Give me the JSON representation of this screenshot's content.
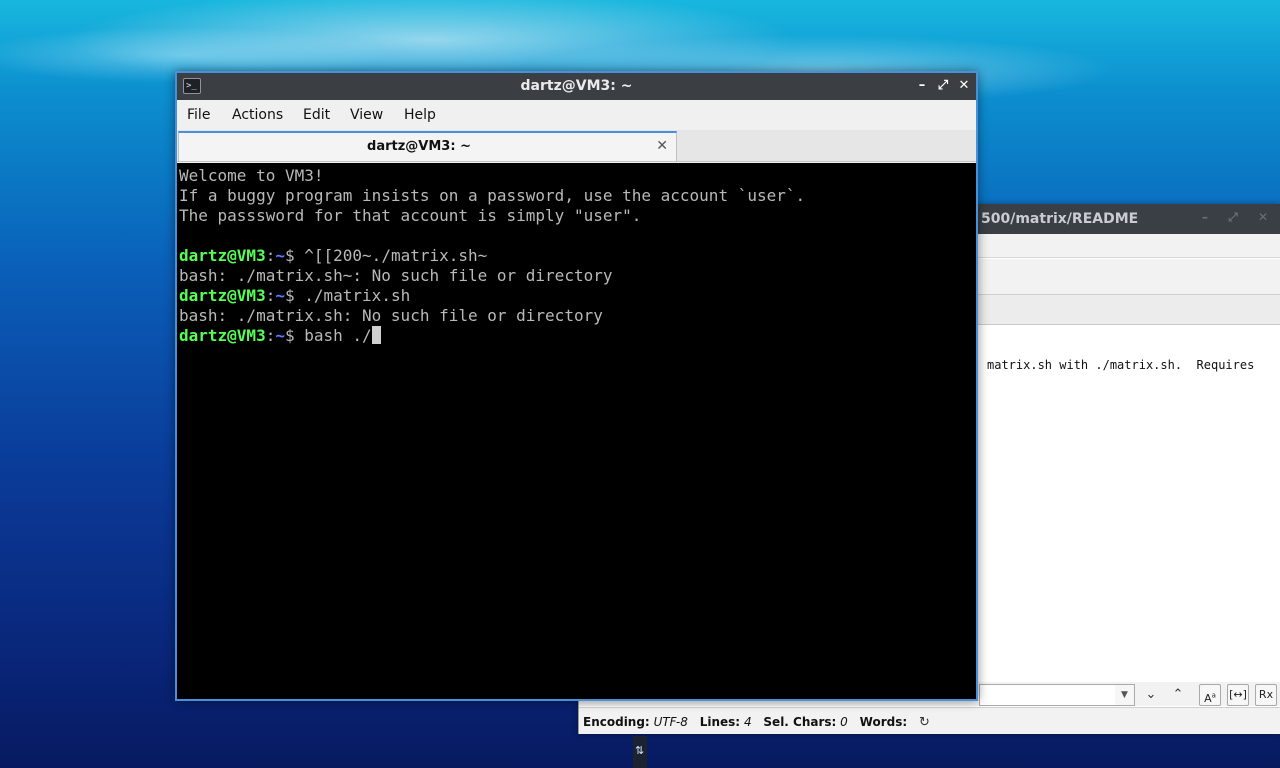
{
  "editor": {
    "title": "500/matrix/README",
    "body_text": "matrix.sh with ./matrix.sh.  Requires",
    "search": {
      "value": ""
    },
    "status": {
      "encoding_label": "Encoding:",
      "encoding_value": "UTF-8",
      "lines_label": "Lines:",
      "lines_value": "4",
      "sel_label": "Sel. Chars:",
      "sel_value": "0",
      "words_label": "Words:"
    }
  },
  "terminal": {
    "title": "dartz@VM3: ~",
    "menu": [
      "File",
      "Actions",
      "Edit",
      "View",
      "Help"
    ],
    "tab_label": "dartz@VM3: ~",
    "welcome": [
      "Welcome to VM3!",
      "If a buggy program insists on a password, use the account `user`.",
      "The passsword for that account is simply \"user\"."
    ],
    "prompt": {
      "user_host": "dartz@VM3",
      "colon": ":",
      "dir": "~",
      "dollar": "$ "
    },
    "commands": [
      {
        "cmd": "^[[200~./matrix.sh~",
        "output": "bash: ./matrix.sh~: No such file or directory"
      },
      {
        "cmd": "./matrix.sh",
        "output": "bash: ./matrix.sh: No such file or directory"
      }
    ],
    "current_cmd": "bash ./"
  }
}
